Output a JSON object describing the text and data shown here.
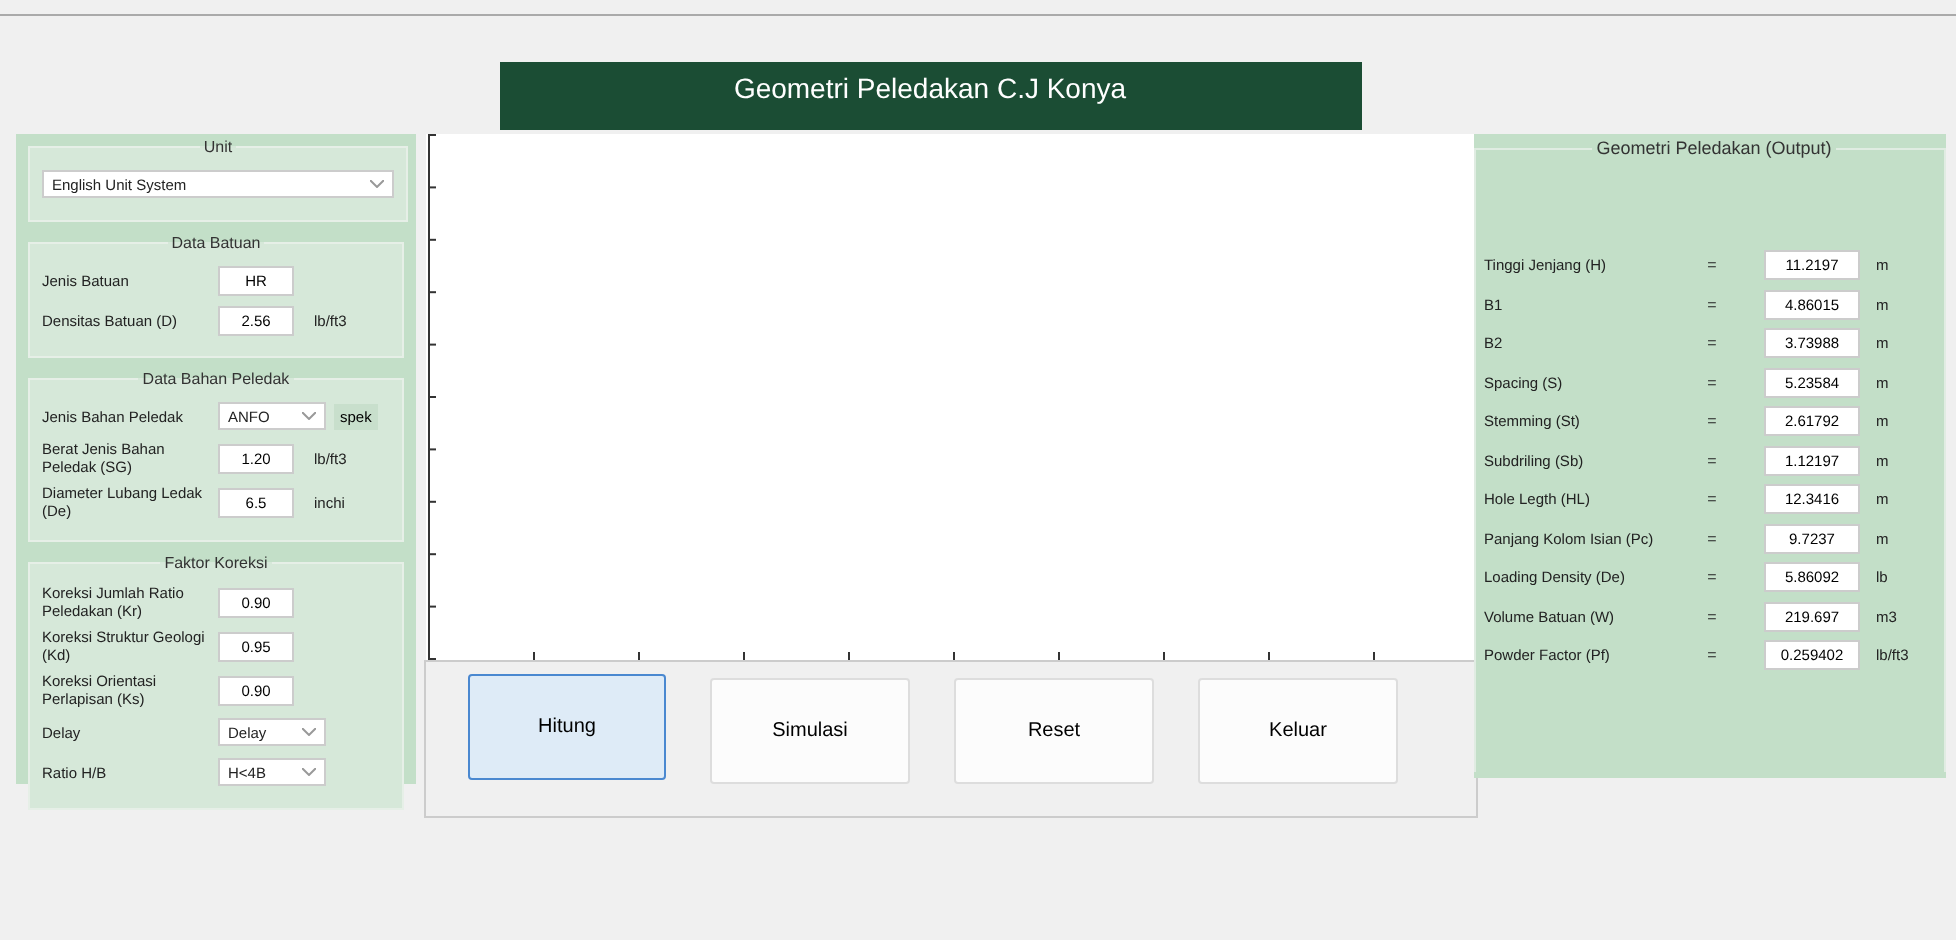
{
  "title": "Geometri Peledakan C.J Konya",
  "input_sections": [
    {
      "legend": "Unit",
      "rows": [
        {
          "kind": "wide-select",
          "value": "English Unit System"
        }
      ]
    },
    {
      "legend": "Data Batuan",
      "rows": [
        {
          "kind": "input",
          "label": "Jenis Batuan",
          "value": "HR"
        },
        {
          "kind": "input",
          "label": "Densitas Batuan (D)",
          "value": "2.56",
          "unit": "lb/ft3"
        }
      ]
    },
    {
      "legend": "Data Bahan Peledak",
      "rows": [
        {
          "kind": "select",
          "label": "Jenis Bahan Peledak",
          "value": "ANFO",
          "button": "spek"
        },
        {
          "kind": "input",
          "label": "Berat Jenis Bahan Peledak (SG)",
          "value": "1.20",
          "unit": "lb/ft3"
        },
        {
          "kind": "input",
          "label": "Diameter Lubang Ledak (De)",
          "value": "6.5",
          "unit": "inchi"
        }
      ]
    },
    {
      "legend": "Faktor Koreksi",
      "rows": [
        {
          "kind": "input",
          "label": "Koreksi Jumlah Ratio Peledakan (Kr)",
          "value": "0.90"
        },
        {
          "kind": "input",
          "label": "Koreksi Struktur Geologi (Kd)",
          "value": "0.95"
        },
        {
          "kind": "input",
          "label": "Koreksi Orientasi Perlapisan (Ks)",
          "value": "0.90"
        },
        {
          "kind": "select",
          "label": "Delay",
          "value": "Delay"
        },
        {
          "kind": "select",
          "label": "Ratio H/B",
          "value": "H<4B"
        }
      ]
    }
  ],
  "buttons": [
    {
      "label": "Hitung",
      "selected": true
    },
    {
      "label": "Simulasi",
      "selected": false
    },
    {
      "label": "Reset",
      "selected": false
    },
    {
      "label": "Keluar",
      "selected": false
    }
  ],
  "output": {
    "legend": "Geometri Peledakan (Output)",
    "rows": [
      {
        "label": "Tinggi Jenjang (H)",
        "eq": "=",
        "value": "11.2197",
        "unit": "m"
      },
      {
        "label": "B1",
        "eq": "=",
        "value": "4.86015",
        "unit": "m"
      },
      {
        "label": "B2",
        "eq": "=",
        "value": "3.73988",
        "unit": "m"
      },
      {
        "label": "Spacing (S)",
        "eq": "=",
        "value": "5.23584",
        "unit": "m"
      },
      {
        "label": "Stemming (St)",
        "eq": "=",
        "value": "2.61792",
        "unit": "m"
      },
      {
        "label": "Subdriling (Sb)",
        "eq": "=",
        "value": "1.12197",
        "unit": "m"
      },
      {
        "label": "Hole Legth (HL)",
        "eq": "=",
        "value": "12.3416",
        "unit": "m"
      },
      {
        "label": "Panjang Kolom Isian (Pc)",
        "eq": "=",
        "value": "9.7237",
        "unit": "m"
      },
      {
        "label": "Loading Density (De)",
        "eq": "=",
        "value": "5.86092",
        "unit": "lb"
      },
      {
        "label": "Volume Batuan (W)",
        "eq": "=",
        "value": "219.697",
        "unit": "m3"
      },
      {
        "label": "Powder Factor (Pf)",
        "eq": "=",
        "value": "0.259402",
        "unit": "lb/ft3"
      }
    ]
  }
}
